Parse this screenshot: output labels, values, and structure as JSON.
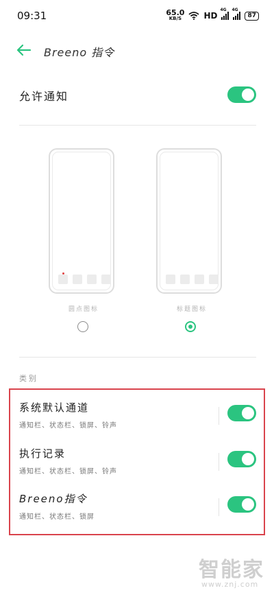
{
  "status_bar": {
    "time": "09:31",
    "speed_value": "65.0",
    "speed_unit": "KB/S",
    "hd": "HD",
    "signal1": "4G",
    "signal2": "4G",
    "battery": "87"
  },
  "header": {
    "title": "Breeno 指令"
  },
  "allow_notifications": {
    "label": "允许通知",
    "enabled": true
  },
  "styles": {
    "option1_caption": "圆点图标",
    "option2_caption": "标题图标",
    "selected_index": 1
  },
  "categories": {
    "section_label": "类别",
    "items": [
      {
        "title": "系统默认通道",
        "subtitle": "通知栏、状态栏、锁屏、铃声",
        "enabled": true
      },
      {
        "title": "执行记录",
        "subtitle": "通知栏、状态栏、锁屏、铃声",
        "enabled": true
      },
      {
        "title": "Breeno指令",
        "subtitle": "通知栏、状态栏、锁屏",
        "enabled": true
      }
    ]
  },
  "watermark": {
    "brand": "智能家",
    "url": "www.znj.com"
  },
  "colors": {
    "accent": "#2bc480",
    "highlight": "#d9434c"
  }
}
